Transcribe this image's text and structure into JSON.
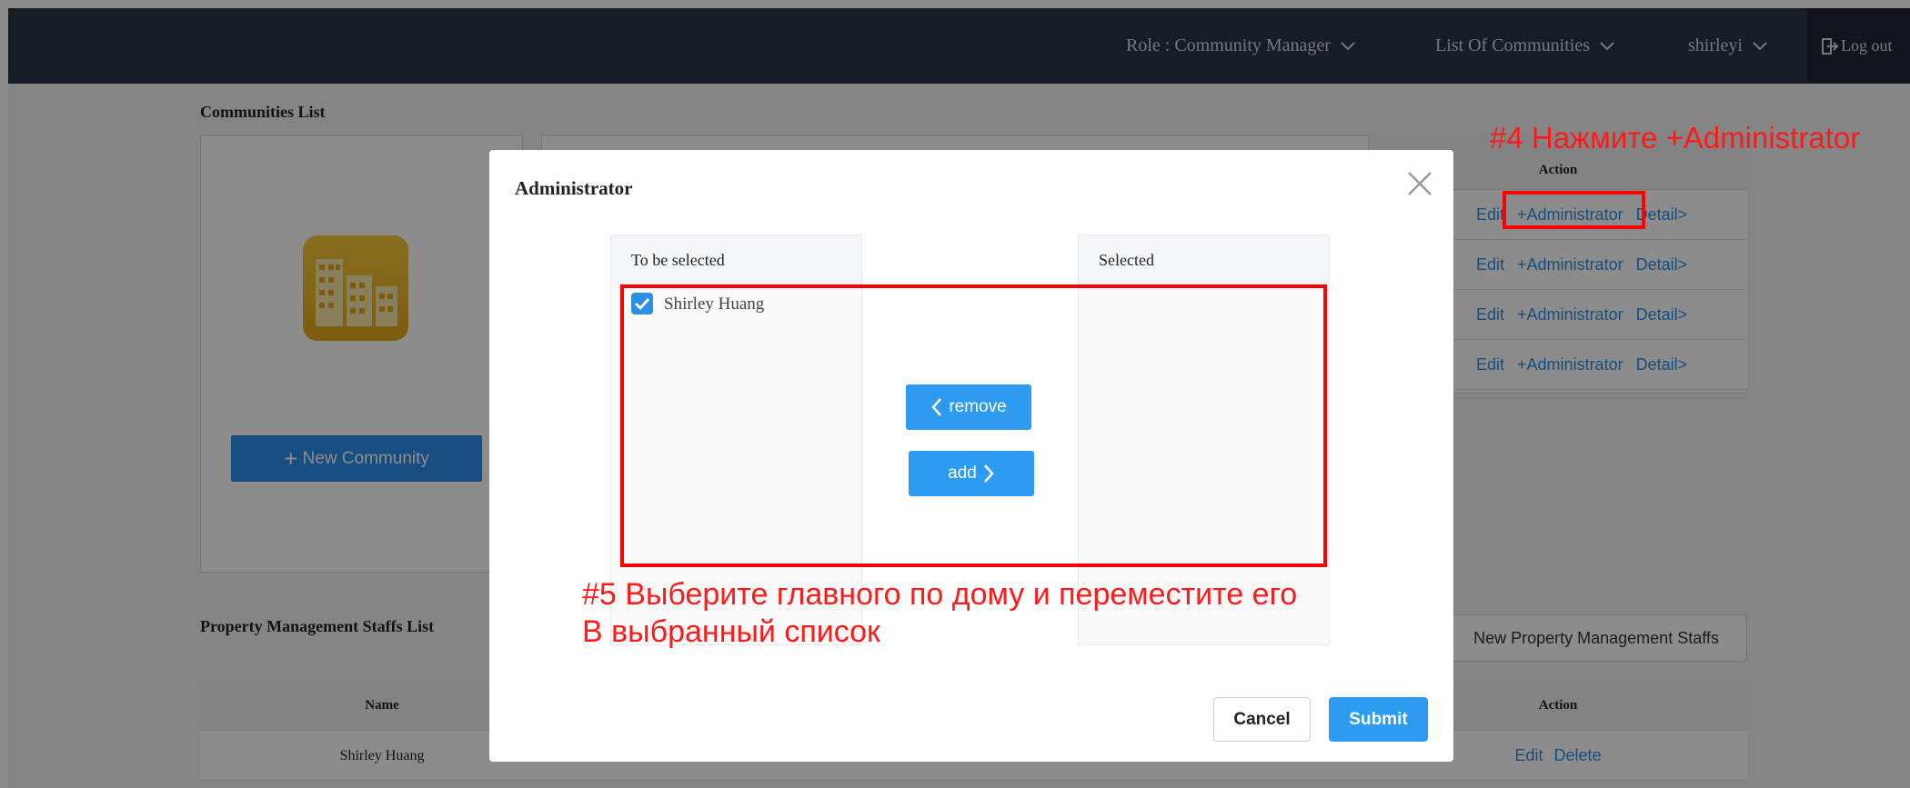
{
  "topbar": {
    "role": "Role : Community Manager",
    "communities": "List Of Communities",
    "user": "shirleyi",
    "logout": "Log out"
  },
  "communities_list": {
    "title": "Communities List",
    "new_button": "New Community",
    "action_header": "Action",
    "rows": [
      {
        "edit": "Edit",
        "admin": "+Administrator",
        "detail": "Detail>"
      },
      {
        "edit": "Edit",
        "admin": "+Administrator",
        "detail": "Detail>"
      },
      {
        "edit": "Edit",
        "admin": "+Administrator",
        "detail": "Detail>"
      },
      {
        "edit": "Edit",
        "admin": "+Administrator",
        "detail": "Detail>"
      }
    ]
  },
  "staff_list": {
    "title": "Property Management Staffs List",
    "new_button": "New Property Management Staffs",
    "headers": {
      "name": "Name",
      "action": "Action"
    },
    "rows": [
      {
        "name": "Shirley Huang",
        "edit": "Edit",
        "delete": "Delete"
      }
    ]
  },
  "modal": {
    "title": "Administrator",
    "left_header": "To be selected",
    "right_header": "Selected",
    "items": [
      {
        "label": "Shirley Huang",
        "checked": true
      }
    ],
    "remove_label": "remove",
    "add_label": "add",
    "cancel_label": "Cancel",
    "submit_label": "Submit"
  },
  "annotations": {
    "step4": "#4 Нажмите +Administrator",
    "step5_line1": "#5 Выберите главного по дому и переместите его",
    "step5_line2": "В выбранный список"
  },
  "colors": {
    "accent": "#2d9cf0",
    "topbar": "#2b3543",
    "annotation": "#ff0000"
  }
}
